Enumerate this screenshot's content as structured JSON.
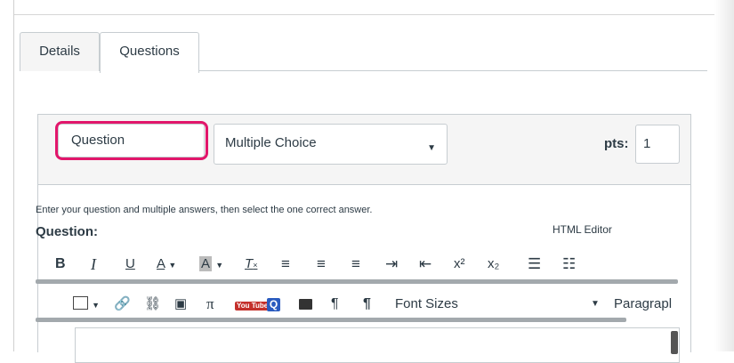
{
  "tabs": [
    {
      "label": "Details"
    },
    {
      "label": "Questions"
    }
  ],
  "question": {
    "name_value": "Question",
    "type_value": "Multiple Choice",
    "pts_label": "pts:",
    "pts_value": "1",
    "instructions": "Enter your question and multiple answers, then select the one correct answer.",
    "question_label": "Question:",
    "html_editor_link": "HTML Editor"
  },
  "toolbar_row1": {
    "bold": "B",
    "italic": "I",
    "underline": "U",
    "font_color": "A",
    "bg_color": "A",
    "clear_format": "T",
    "superscript": "x²",
    "subscript": "x₂"
  },
  "toolbar_row2": {
    "pi": "π",
    "youtube": "You Tube",
    "quizlet": "Q",
    "font_sizes": "Font Sizes",
    "paragraph": "Paragrapl"
  },
  "colors": {
    "highlight": "#e2166b",
    "border": "#c7cdd1",
    "text": "#2d3b45"
  }
}
